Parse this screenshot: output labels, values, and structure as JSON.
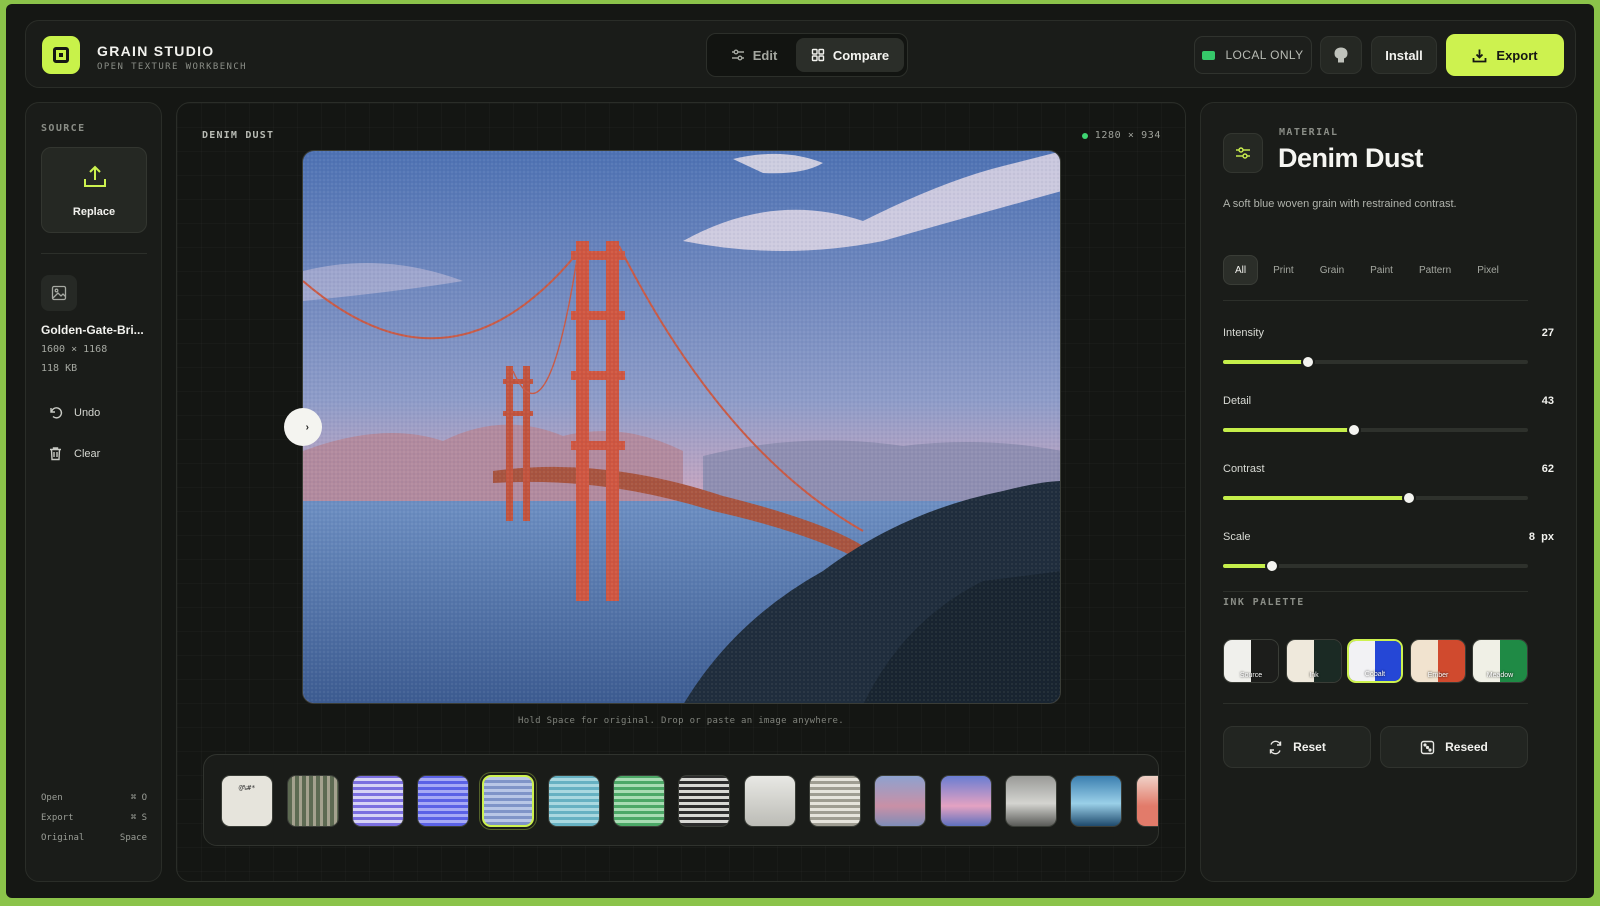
{
  "header": {
    "brand_title": "GRAIN STUDIO",
    "brand_subtitle": "OPEN TEXTURE WORKBENCH",
    "mode_tabs": [
      {
        "label": "Edit",
        "icon": "sliders-icon",
        "active": false
      },
      {
        "label": "Compare",
        "icon": "grid-icon",
        "active": true
      }
    ],
    "local_only_label": "LOCAL ONLY",
    "install_label": "Install",
    "export_label": "Export",
    "accent_color": "#cdf24f"
  },
  "source": {
    "section_label": "SOURCE",
    "replace_label": "Replace",
    "file_name": "Golden-Gate-Bri...",
    "file_dims": "1600 × 1168",
    "file_size": "118 KB",
    "undo_label": "Undo",
    "clear_label": "Clear",
    "shortcuts": [
      {
        "label": "Open",
        "keys": "⌘ O"
      },
      {
        "label": "Export",
        "keys": "⌘ S"
      },
      {
        "label": "Original",
        "keys": "Space"
      }
    ]
  },
  "canvas": {
    "title": "DENIM DUST",
    "dims": "1280 × 934",
    "hint": "Hold Space for original. Drop or paste an image anywhere.",
    "filmstrip": [
      {
        "label": "@%#*",
        "style": "ascii"
      },
      {
        "style": "weave-dark"
      },
      {
        "style": "weave-purple"
      },
      {
        "style": "weave-blue"
      },
      {
        "style": "denim",
        "active": true
      },
      {
        "style": "weave-cyan"
      },
      {
        "style": "weave-green"
      },
      {
        "style": "weave-mono"
      },
      {
        "style": "photo-fade"
      },
      {
        "style": "weave-light"
      },
      {
        "style": "photo-warm"
      },
      {
        "style": "photo-pink"
      },
      {
        "style": "photo-gray"
      },
      {
        "style": "photo-teal"
      },
      {
        "style": "photo-red"
      }
    ]
  },
  "material": {
    "section_label": "MATERIAL",
    "title": "Denim Dust",
    "description": "A soft blue woven grain with restrained contrast.",
    "categories": [
      "All",
      "Print",
      "Grain",
      "Paint",
      "Pattern",
      "Pixel"
    ],
    "active_category": "All",
    "sliders": [
      {
        "label": "Intensity",
        "value": "27",
        "fraction": 0.28
      },
      {
        "label": "Detail",
        "value": "43",
        "fraction": 0.43
      },
      {
        "label": "Contrast",
        "value": "62",
        "fraction": 0.61
      },
      {
        "label": "Scale",
        "value": "8  px",
        "fraction": 0.16
      }
    ],
    "palette_label": "INK PALETTE",
    "palettes": [
      {
        "name": "Source",
        "a": "#f0f0ec",
        "b": "#1c1d1b"
      },
      {
        "name": "Ink",
        "a": "#efe9dc",
        "b": "#1b2a24"
      },
      {
        "name": "Cobalt",
        "a": "#f2f2f4",
        "b": "#2547d6",
        "active": true
      },
      {
        "name": "Ember",
        "a": "#f1e3cf",
        "b": "#d04a2e"
      },
      {
        "name": "Meadow",
        "a": "#f0f0e6",
        "b": "#1f8a45"
      }
    ],
    "reset_label": "Reset",
    "reseed_label": "Reseed"
  }
}
